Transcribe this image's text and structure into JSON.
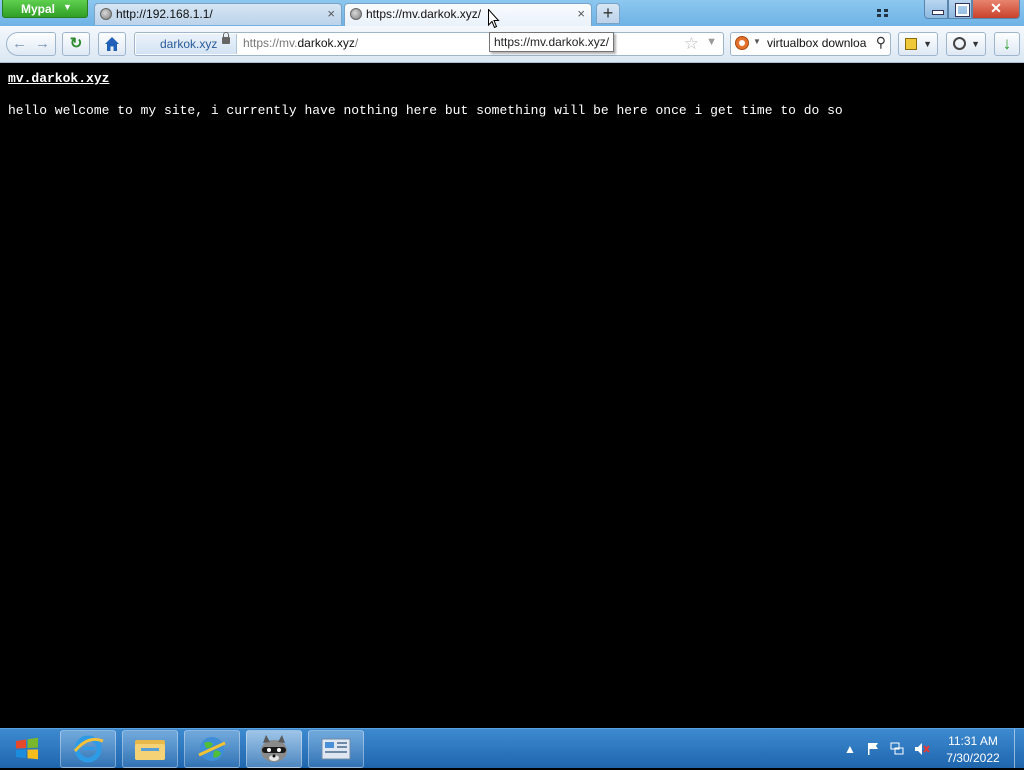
{
  "browser": {
    "menu_button": "Mypal",
    "tabs": [
      {
        "title": "http://192.168.1.1/",
        "active": false
      },
      {
        "title": "https://mv.darkok.xyz/",
        "active": true
      }
    ],
    "new_tab_label": "+",
    "close_tab_glyph": "×",
    "window_controls": {
      "close_glyph": "✕"
    },
    "navbar": {
      "identity_label": "darkok.xyz",
      "url_prefix": "https://mv.",
      "url_domain": "darkok.xyz",
      "url_suffix": "/",
      "search_text": "virtualbox downloa",
      "tooltip": "https://mv.darkok.xyz/"
    }
  },
  "page": {
    "heading": "mv.darkok.xyz",
    "body": "hello welcome to my site, i currently have nothing here but something will be here once i get time to do so"
  },
  "taskbar": {
    "apps": [
      {
        "name": "internet-explorer-icon"
      },
      {
        "name": "file-explorer-icon"
      },
      {
        "name": "network-globe-icon"
      },
      {
        "name": "raccoon-app-icon"
      },
      {
        "name": "control-panel-icon"
      }
    ],
    "clock": {
      "time": "11:31 AM",
      "date": "7/30/2022"
    }
  },
  "colors": {
    "page_background": "#000000",
    "page_text": "#ffffff",
    "taskbar": "#2b76bf"
  }
}
